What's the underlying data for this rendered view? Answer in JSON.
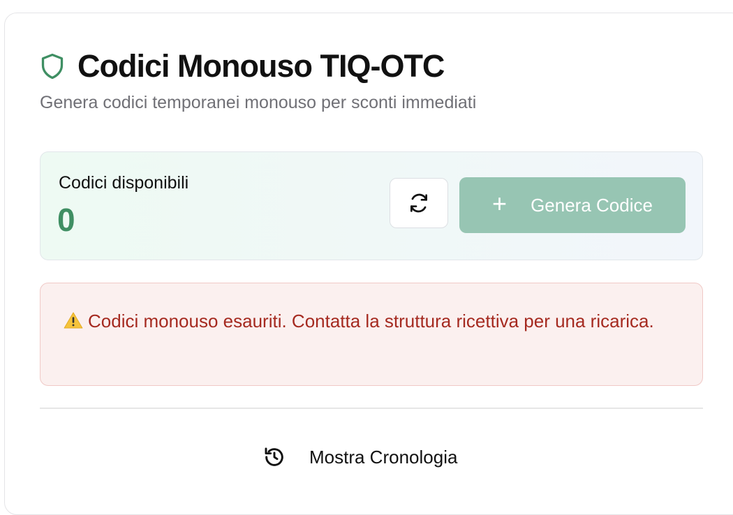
{
  "header": {
    "title": "Codici Monouso TIQ-OTC",
    "subtitle": "Genera codici temporanei monouso per sconti immediati",
    "icon": "shield-icon"
  },
  "stats": {
    "label": "Codici disponibili",
    "count": "0",
    "refresh_icon": "refresh-icon",
    "generate_label": "Genera Codice",
    "generate_icon": "plus-icon"
  },
  "alert": {
    "icon": "warning-icon",
    "message": "Codici monouso esauriti. Contatta la struttura ricettiva per una ricarica."
  },
  "footer": {
    "history_label": "Mostra Cronologia",
    "history_icon": "history-icon"
  },
  "colors": {
    "accent_green": "#3f8f63",
    "button_green_disabled": "#97c5b3",
    "alert_text": "#a52a20",
    "alert_bg": "#fbf0ef"
  }
}
